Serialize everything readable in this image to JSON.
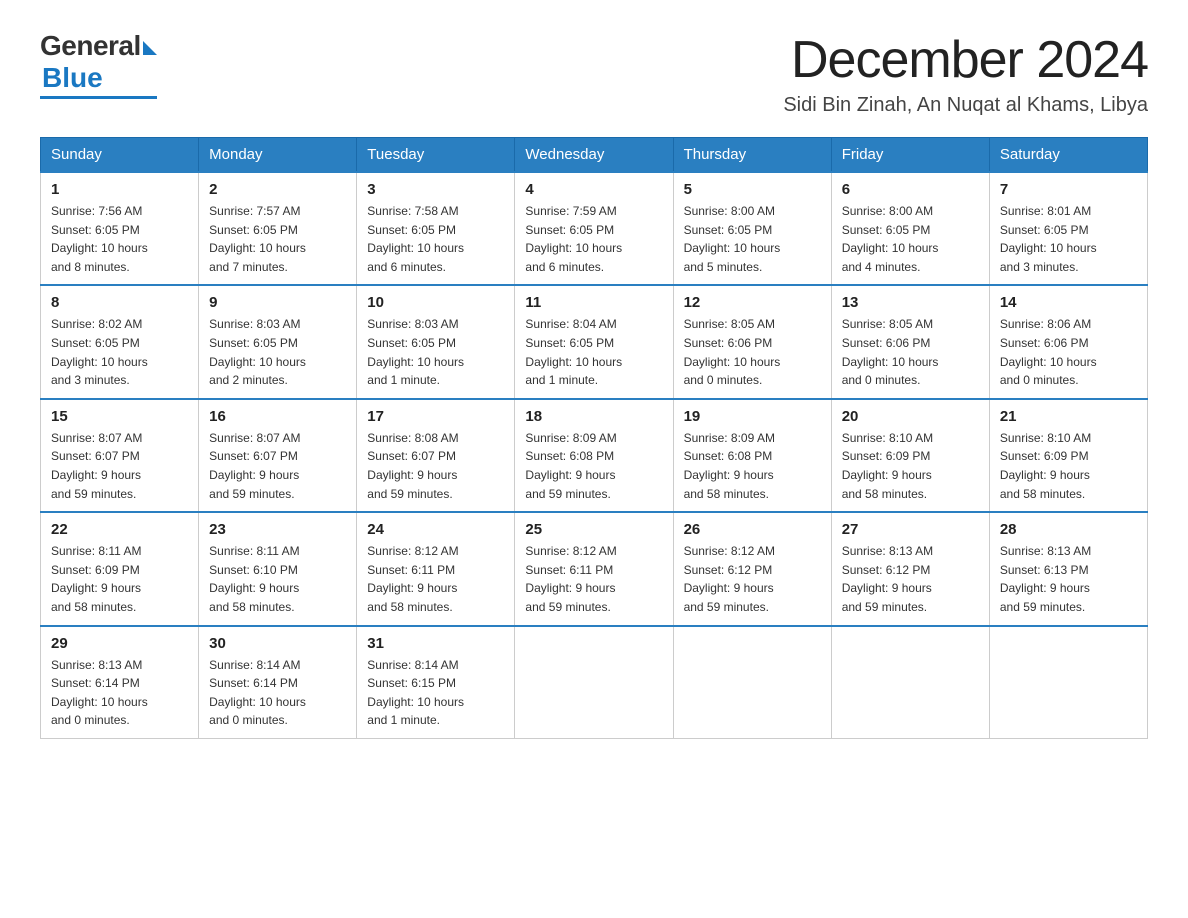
{
  "logo": {
    "general": "General",
    "blue": "Blue"
  },
  "header": {
    "month": "December 2024",
    "location": "Sidi Bin Zinah, An Nuqat al Khams, Libya"
  },
  "days_of_week": [
    "Sunday",
    "Monday",
    "Tuesday",
    "Wednesday",
    "Thursday",
    "Friday",
    "Saturday"
  ],
  "weeks": [
    [
      {
        "day": "1",
        "info": "Sunrise: 7:56 AM\nSunset: 6:05 PM\nDaylight: 10 hours\nand 8 minutes."
      },
      {
        "day": "2",
        "info": "Sunrise: 7:57 AM\nSunset: 6:05 PM\nDaylight: 10 hours\nand 7 minutes."
      },
      {
        "day": "3",
        "info": "Sunrise: 7:58 AM\nSunset: 6:05 PM\nDaylight: 10 hours\nand 6 minutes."
      },
      {
        "day": "4",
        "info": "Sunrise: 7:59 AM\nSunset: 6:05 PM\nDaylight: 10 hours\nand 6 minutes."
      },
      {
        "day": "5",
        "info": "Sunrise: 8:00 AM\nSunset: 6:05 PM\nDaylight: 10 hours\nand 5 minutes."
      },
      {
        "day": "6",
        "info": "Sunrise: 8:00 AM\nSunset: 6:05 PM\nDaylight: 10 hours\nand 4 minutes."
      },
      {
        "day": "7",
        "info": "Sunrise: 8:01 AM\nSunset: 6:05 PM\nDaylight: 10 hours\nand 3 minutes."
      }
    ],
    [
      {
        "day": "8",
        "info": "Sunrise: 8:02 AM\nSunset: 6:05 PM\nDaylight: 10 hours\nand 3 minutes."
      },
      {
        "day": "9",
        "info": "Sunrise: 8:03 AM\nSunset: 6:05 PM\nDaylight: 10 hours\nand 2 minutes."
      },
      {
        "day": "10",
        "info": "Sunrise: 8:03 AM\nSunset: 6:05 PM\nDaylight: 10 hours\nand 1 minute."
      },
      {
        "day": "11",
        "info": "Sunrise: 8:04 AM\nSunset: 6:05 PM\nDaylight: 10 hours\nand 1 minute."
      },
      {
        "day": "12",
        "info": "Sunrise: 8:05 AM\nSunset: 6:06 PM\nDaylight: 10 hours\nand 0 minutes."
      },
      {
        "day": "13",
        "info": "Sunrise: 8:05 AM\nSunset: 6:06 PM\nDaylight: 10 hours\nand 0 minutes."
      },
      {
        "day": "14",
        "info": "Sunrise: 8:06 AM\nSunset: 6:06 PM\nDaylight: 10 hours\nand 0 minutes."
      }
    ],
    [
      {
        "day": "15",
        "info": "Sunrise: 8:07 AM\nSunset: 6:07 PM\nDaylight: 9 hours\nand 59 minutes."
      },
      {
        "day": "16",
        "info": "Sunrise: 8:07 AM\nSunset: 6:07 PM\nDaylight: 9 hours\nand 59 minutes."
      },
      {
        "day": "17",
        "info": "Sunrise: 8:08 AM\nSunset: 6:07 PM\nDaylight: 9 hours\nand 59 minutes."
      },
      {
        "day": "18",
        "info": "Sunrise: 8:09 AM\nSunset: 6:08 PM\nDaylight: 9 hours\nand 59 minutes."
      },
      {
        "day": "19",
        "info": "Sunrise: 8:09 AM\nSunset: 6:08 PM\nDaylight: 9 hours\nand 58 minutes."
      },
      {
        "day": "20",
        "info": "Sunrise: 8:10 AM\nSunset: 6:09 PM\nDaylight: 9 hours\nand 58 minutes."
      },
      {
        "day": "21",
        "info": "Sunrise: 8:10 AM\nSunset: 6:09 PM\nDaylight: 9 hours\nand 58 minutes."
      }
    ],
    [
      {
        "day": "22",
        "info": "Sunrise: 8:11 AM\nSunset: 6:09 PM\nDaylight: 9 hours\nand 58 minutes."
      },
      {
        "day": "23",
        "info": "Sunrise: 8:11 AM\nSunset: 6:10 PM\nDaylight: 9 hours\nand 58 minutes."
      },
      {
        "day": "24",
        "info": "Sunrise: 8:12 AM\nSunset: 6:11 PM\nDaylight: 9 hours\nand 58 minutes."
      },
      {
        "day": "25",
        "info": "Sunrise: 8:12 AM\nSunset: 6:11 PM\nDaylight: 9 hours\nand 59 minutes."
      },
      {
        "day": "26",
        "info": "Sunrise: 8:12 AM\nSunset: 6:12 PM\nDaylight: 9 hours\nand 59 minutes."
      },
      {
        "day": "27",
        "info": "Sunrise: 8:13 AM\nSunset: 6:12 PM\nDaylight: 9 hours\nand 59 minutes."
      },
      {
        "day": "28",
        "info": "Sunrise: 8:13 AM\nSunset: 6:13 PM\nDaylight: 9 hours\nand 59 minutes."
      }
    ],
    [
      {
        "day": "29",
        "info": "Sunrise: 8:13 AM\nSunset: 6:14 PM\nDaylight: 10 hours\nand 0 minutes."
      },
      {
        "day": "30",
        "info": "Sunrise: 8:14 AM\nSunset: 6:14 PM\nDaylight: 10 hours\nand 0 minutes."
      },
      {
        "day": "31",
        "info": "Sunrise: 8:14 AM\nSunset: 6:15 PM\nDaylight: 10 hours\nand 1 minute."
      },
      {
        "day": "",
        "info": ""
      },
      {
        "day": "",
        "info": ""
      },
      {
        "day": "",
        "info": ""
      },
      {
        "day": "",
        "info": ""
      }
    ]
  ]
}
